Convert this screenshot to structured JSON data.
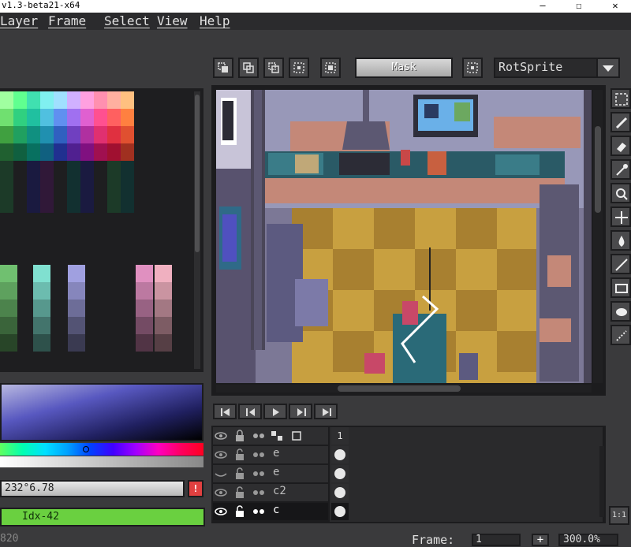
{
  "title_bar": {
    "title": "v1.3-beta21-x64",
    "minimize": "—",
    "maximize": "☐",
    "close": "✕"
  },
  "menu": {
    "items": [
      "Layer",
      "Frame",
      "Select",
      "View",
      "Help"
    ]
  },
  "toolbar": {
    "icons": [
      "selection-mode-replace-icon",
      "selection-mode-add-icon",
      "selection-mode-subtract-icon",
      "selection-mode-intersect-icon",
      "pivot-icon",
      "transparent-color-options-icon"
    ],
    "mask_label": "Mask",
    "rotation_algorithm": "RotSprite"
  },
  "palette": {
    "rows": 18
  },
  "color_bar": {
    "hex_value": "232°6.78",
    "warning": "!",
    "index_label": "Idx-42"
  },
  "status": {
    "left_text": "820",
    "frame_label": "Frame:",
    "frame_value": "1",
    "add_label": "+",
    "zoom_value": "300.0%",
    "zoom_reset": "1:1"
  },
  "timeline": {
    "frame_number": "1",
    "layers": [
      {
        "name": "e",
        "visible": true,
        "locked": false,
        "selected": false
      },
      {
        "name": "e",
        "visible": false,
        "locked": false,
        "selected": false
      },
      {
        "name": "c2",
        "visible": true,
        "locked": false,
        "selected": false
      },
      {
        "name": "c",
        "visible": true,
        "locked": false,
        "selected": true
      }
    ]
  },
  "tools": [
    "rectangular-marquee-icon",
    "pencil-icon",
    "eraser-icon",
    "eyedropper-icon",
    "zoom-icon",
    "move-icon",
    "paint-bucket-icon",
    "line-icon",
    "rectangle-icon",
    "ellipse-icon",
    "blur-icon"
  ],
  "playback": [
    "first-frame-icon",
    "previous-frame-icon",
    "play-icon",
    "next-frame-icon",
    "last-frame-icon"
  ]
}
